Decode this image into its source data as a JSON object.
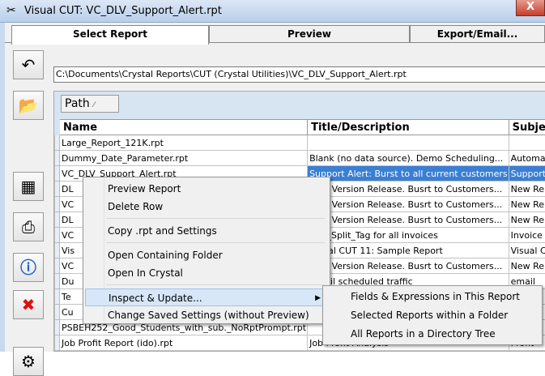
{
  "window": {
    "title": "Visual CUT:  VC_DLV_Support_Alert.rpt",
    "close_label": "X"
  },
  "tabs": [
    {
      "label": "Select Report"
    },
    {
      "label": "Preview"
    },
    {
      "label": "Export/Email..."
    }
  ],
  "path": {
    "value": "C:\\Documents\\Crystal Reports\\CUT (Crystal Utilities)\\VC_DLV_Support_Alert.rpt"
  },
  "grid": {
    "group_header": "Path",
    "columns": [
      "Name",
      "Title/Description",
      "Subject"
    ],
    "rows": [
      [
        "Large_Report_121K.rpt",
        "",
        ""
      ],
      [
        "Dummy_Date_Parameter.rpt",
        "Blank (no data source). Demo Scheduling...",
        "Automation"
      ],
      [
        "VC_DLV_Support_Alert.rpt",
        "Support Alert: Burst to all current customers",
        "Support"
      ],
      [
        "DL",
        "New Version Release. Busrt to Customers...",
        "New Release"
      ],
      [
        "VC",
        "New Version Release. Busrt to Customers...",
        "New Release"
      ],
      [
        "DL",
        "New Version Release. Busrt to Customers...",
        "New Release"
      ],
      [
        "VC",
        "PDF_Split_Tag for all invoices",
        "Invoice"
      ],
      [
        "Vis",
        "Visual CUT 11: Sample Report",
        "Visual CUT"
      ],
      [
        "VC",
        "New Version Release. Busrt to Customers...",
        "New Release"
      ],
      [
        "Du",
        "Gmail scheduled traffic",
        "email"
      ],
      [
        "Te",
        "",
        ""
      ],
      [
        "Cu",
        "",
        ""
      ],
      [
        "PSBEH252_Good_Students_with_sub._NoRptPrompt.rpt",
        "",
        ""
      ],
      [
        "Job Profit Report (ido).rpt",
        "Job Profit Analysis",
        "Profit"
      ]
    ]
  },
  "context_menu": {
    "items": [
      "Preview Report",
      "Delete Row",
      "Copy .rpt and Settings",
      "Open Containing Folder",
      "Open In Crystal",
      "Inspect & Update...",
      "Change Saved Settings (without Preview)"
    ],
    "submenu_arrow": "▶"
  },
  "submenu": {
    "items": [
      "Fields & Expressions in This Report",
      "Selected Reports within a Folder",
      "All Reports in a Directory Tree"
    ]
  },
  "toolbar_icons": [
    "undo-icon",
    "open-folder-icon",
    "rubiks-cube-icon",
    "print-icon",
    "info-icon",
    "cancel-icon",
    "settings-icon"
  ]
}
